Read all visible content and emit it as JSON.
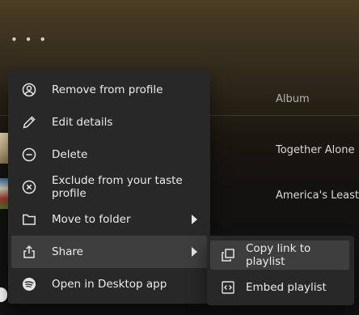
{
  "header": {
    "more_dots": "• • •"
  },
  "table": {
    "column_album": "Album",
    "rows": [
      {
        "album": "Together Alone"
      },
      {
        "album": "America's Least W"
      }
    ]
  },
  "context_menu": {
    "items": [
      {
        "label": "Remove from profile",
        "icon": "user-circle-icon"
      },
      {
        "label": "Edit details",
        "icon": "pencil-icon"
      },
      {
        "label": "Delete",
        "icon": "minus-circle-icon"
      },
      {
        "label": "Exclude from your taste profile",
        "icon": "x-circle-icon"
      },
      {
        "label": "Move to folder",
        "icon": "folder-icon",
        "has_submenu": true
      },
      {
        "label": "Share",
        "icon": "share-icon",
        "has_submenu": true,
        "active": true
      },
      {
        "label": "Open in Desktop app",
        "icon": "spotify-icon"
      }
    ]
  },
  "share_submenu": {
    "items": [
      {
        "label": "Copy link to playlist",
        "icon": "copy-icon",
        "active": true
      },
      {
        "label": "Embed playlist",
        "icon": "embed-icon"
      }
    ]
  }
}
